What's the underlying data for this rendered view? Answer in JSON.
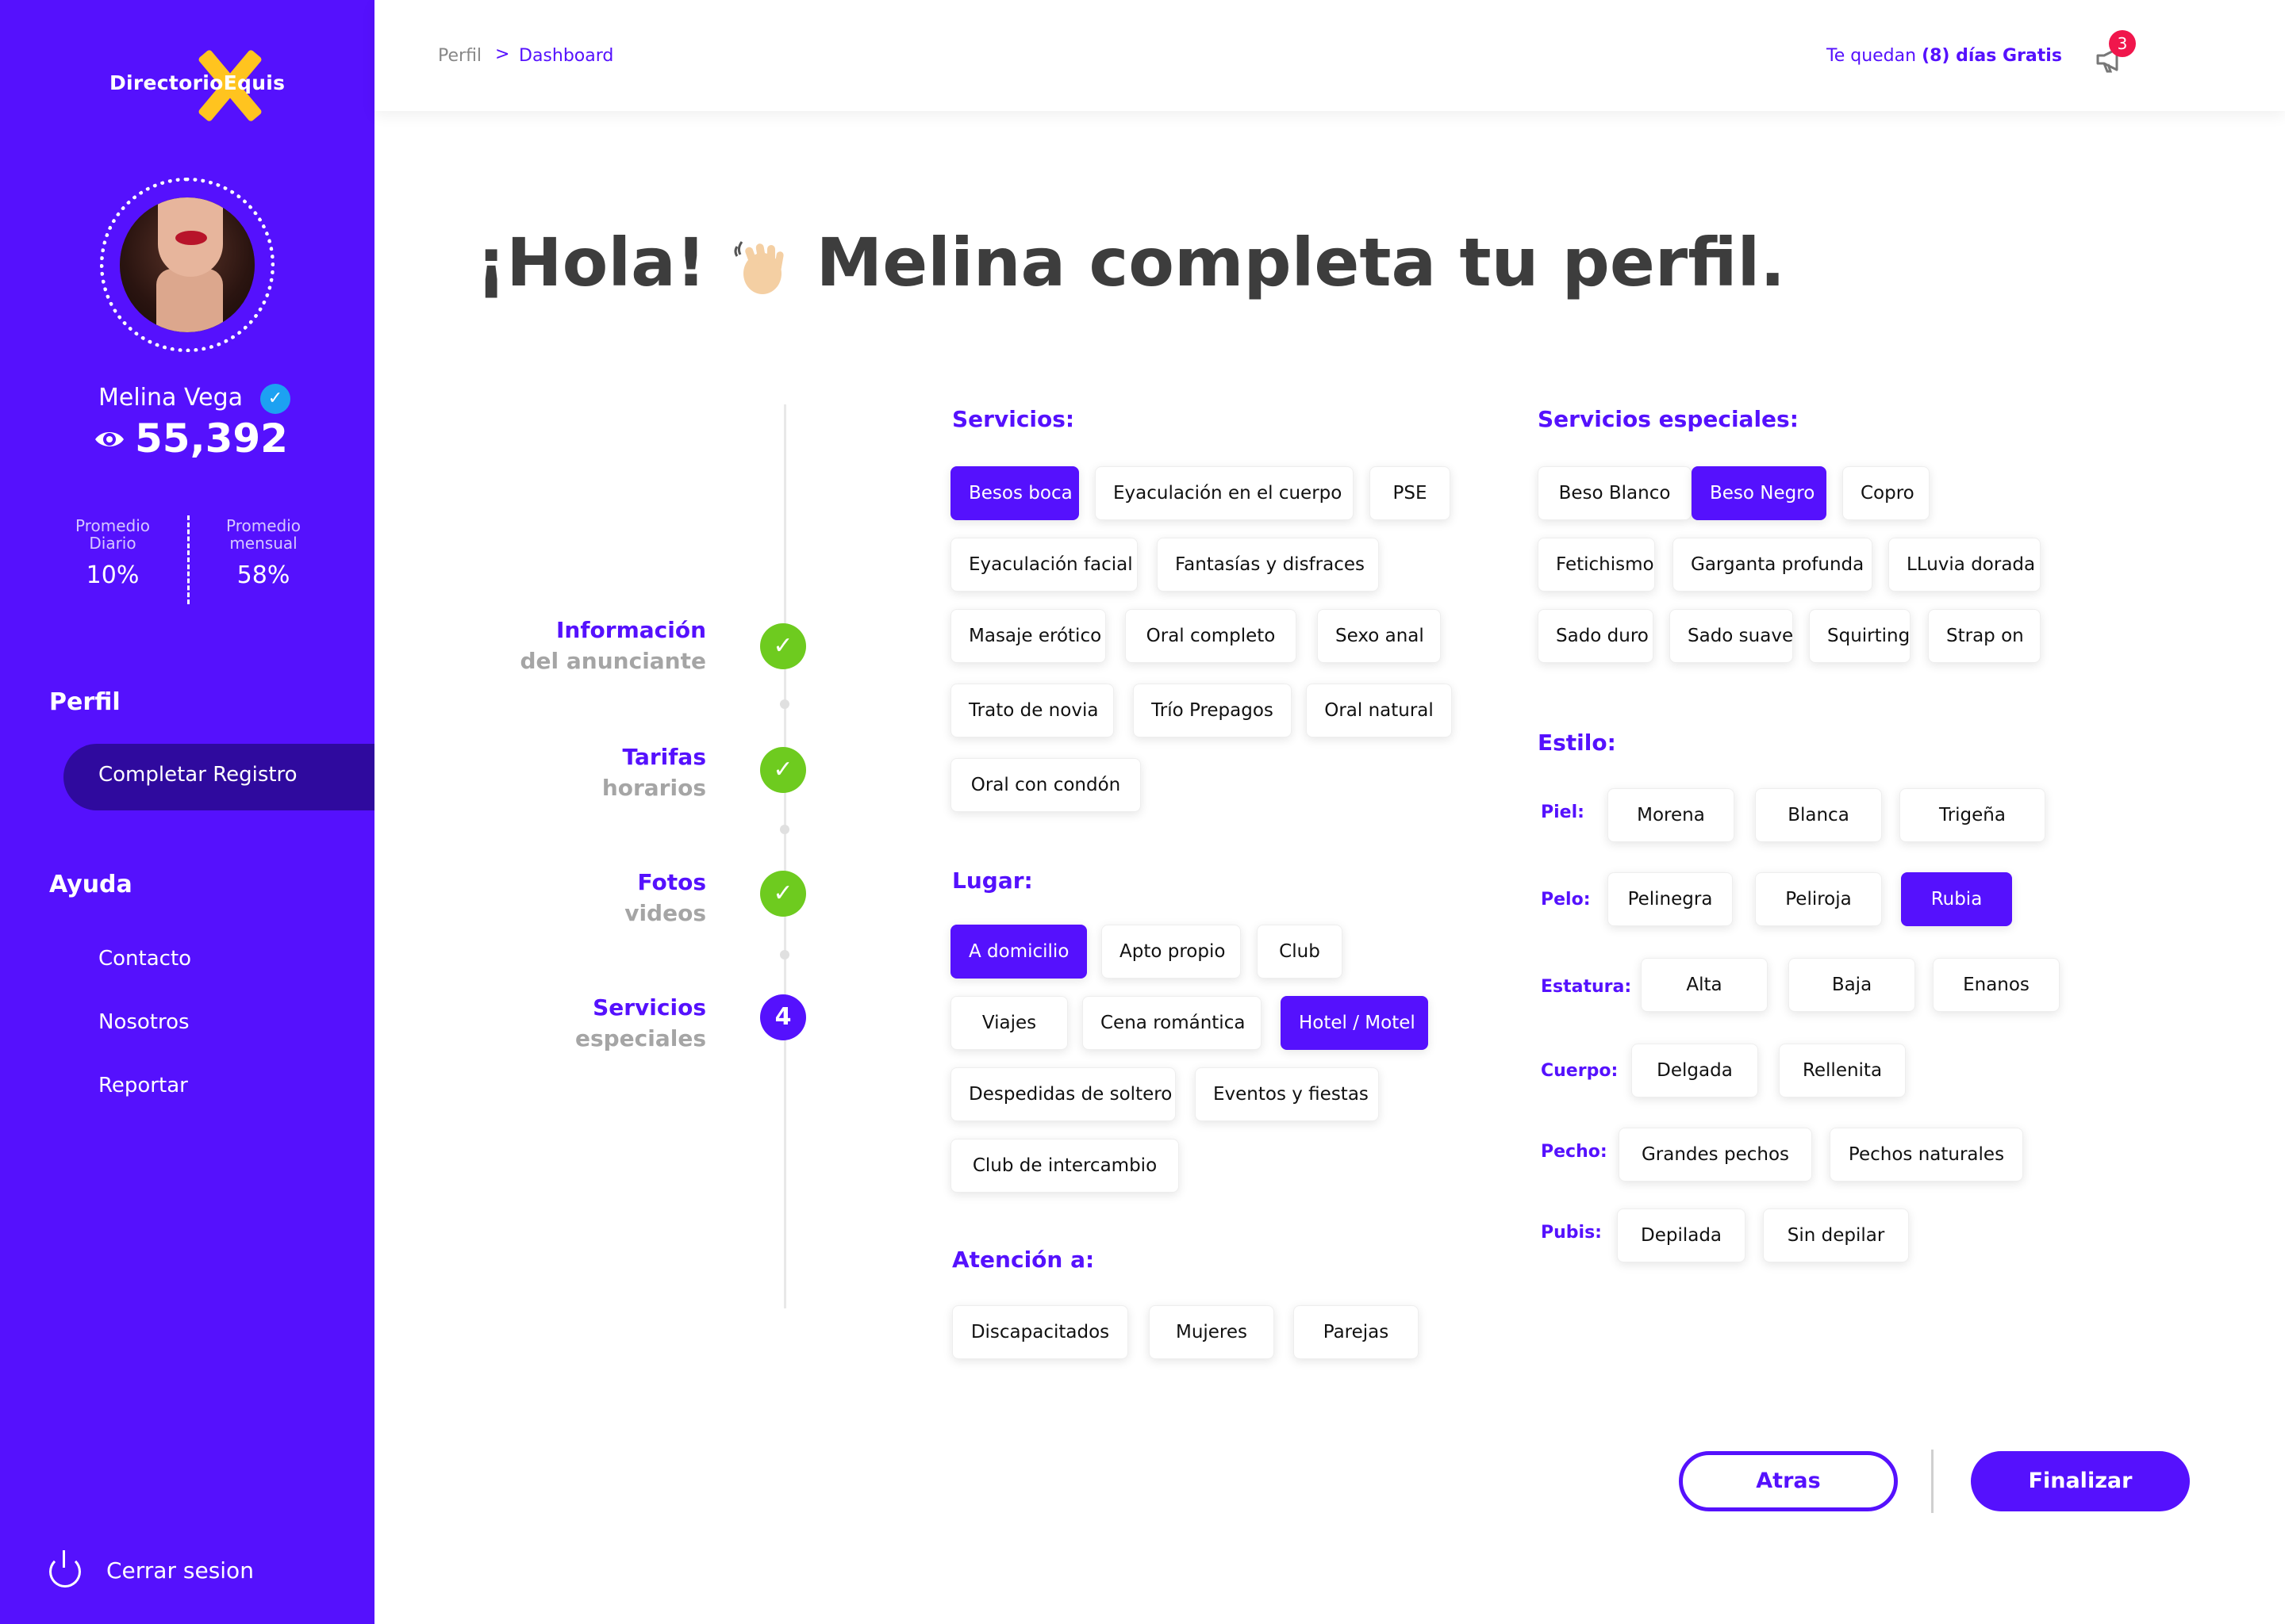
{
  "brand": {
    "name": "DirectorioEquis"
  },
  "user": {
    "name": "Melina Vega",
    "views": "55,392"
  },
  "stats": {
    "daily_label": "Promedio Diario",
    "daily_value": "10%",
    "monthly_label": "Promedio mensual",
    "monthly_value": "58%"
  },
  "nav": {
    "perfil_heading": "Perfil",
    "completar": "Completar Registro",
    "ayuda_heading": "Ayuda",
    "contacto": "Contacto",
    "nosotros": "Nosotros",
    "reportar": "Reportar",
    "logout": "Cerrar sesion"
  },
  "topbar": {
    "crumb_1": "Perfil",
    "crumb_sep": ">",
    "crumb_2": "Dashboard",
    "trial_prefix": "Te quedan ",
    "trial_bold": "(8) días Gratis",
    "notif_count": "3"
  },
  "greeting": {
    "hola": "¡Hola! ",
    "name": " Melina ",
    "bold": "completa tu perfil."
  },
  "steps": [
    {
      "title": "Información",
      "sub": "del anunciante",
      "marker": "✓"
    },
    {
      "title": "Tarifas",
      "sub": "horarios",
      "marker": "✓"
    },
    {
      "title": "Fotos",
      "sub": "videos",
      "marker": "✓"
    },
    {
      "title": "Servicios",
      "sub": "especiales",
      "marker": "4"
    }
  ],
  "servicios": {
    "title": "Servicios:",
    "items": [
      "Besos boca",
      "Eyaculación en el cuerpo",
      "PSE",
      "Eyaculación facial",
      "Fantasías y disfraces",
      "Masaje erótico",
      "Oral completo",
      "Sexo anal",
      "Trato de novia",
      "Trío Prepagos",
      "Oral natural",
      "Oral con condón"
    ]
  },
  "lugar": {
    "title": "Lugar:",
    "items": [
      "A domicilio",
      "Apto propio",
      "Club",
      "Viajes",
      "Cena romántica",
      "Hotel / Motel",
      "Despedidas de soltero",
      "Eventos y fiestas",
      "Club de intercambio"
    ]
  },
  "atencion": {
    "title": "Atención a:",
    "items": [
      "Discapacitados",
      "Mujeres",
      "Parejas"
    ]
  },
  "especiales": {
    "title": "Servicios especiales:",
    "items": [
      "Beso Blanco",
      "Beso Negro",
      "Copro",
      "Fetichismo",
      "Garganta profunda",
      "LLuvia dorada",
      "Sado duro",
      "Sado suave",
      "Squirting",
      "Strap on"
    ]
  },
  "estilo": {
    "title": "Estilo:",
    "piel_label": "Piel:",
    "piel": [
      "Morena",
      "Blanca",
      "Trigeña"
    ],
    "pelo_label": "Pelo:",
    "pelo": [
      "Pelinegra",
      "Peliroja",
      "Rubia"
    ],
    "estatura_label": "Estatura:",
    "estatura": [
      "Alta",
      "Baja",
      "Enanos"
    ],
    "cuerpo_label": "Cuerpo:",
    "cuerpo": [
      "Delgada",
      "Rellenita"
    ],
    "pecho_label": "Pecho:",
    "pecho": [
      "Grandes pechos",
      "Pechos naturales"
    ],
    "pubis_label": "Pubis:",
    "pubis": [
      "Depilada",
      "Sin depilar"
    ]
  },
  "buttons": {
    "back": "Atras",
    "finish": "Finalizar"
  },
  "colors": {
    "accent": "#5511fd",
    "success": "#6ecb1f",
    "badge": "#f0164c",
    "logo_x": "#ffc41f"
  }
}
